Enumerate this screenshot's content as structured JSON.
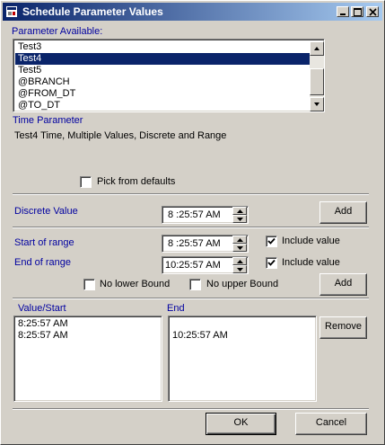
{
  "window": {
    "title": "Schedule Parameter Values"
  },
  "params": {
    "label": "Parameter Available:",
    "items": [
      {
        "text": "Test3",
        "selected": false
      },
      {
        "text": "Test4",
        "selected": true
      },
      {
        "text": "Test5",
        "selected": false
      },
      {
        "text": "@BRANCH",
        "selected": false
      },
      {
        "text": "@FROM_DT",
        "selected": false
      },
      {
        "text": "@TO_DT",
        "selected": false
      }
    ]
  },
  "time_param": {
    "label": "Time Parameter",
    "description": "Test4  Time,  Multiple Values,  Discrete and Range"
  },
  "pick_defaults": {
    "label": "Pick from defaults",
    "checked": false
  },
  "discrete": {
    "label": "Discrete Value",
    "value": "8 :25:57 AM",
    "add_label": "Add"
  },
  "range": {
    "start_label": "Start of range",
    "start_value": "8 :25:57 AM",
    "start_include_label": "Include value",
    "start_include_checked": true,
    "end_label": "End of range",
    "end_value": "10:25:57 AM",
    "end_include_label": "Include value",
    "end_include_checked": true,
    "no_lower_label": "No lower Bound",
    "no_upper_label": "No upper Bound",
    "add_label": "Add"
  },
  "values": {
    "start_header": "Value/Start",
    "end_header": "End",
    "start_items": [
      "8:25:57 AM",
      "8:25:57 AM"
    ],
    "end_items": [
      "",
      "10:25:57 AM"
    ],
    "remove_label": "Remove"
  },
  "footer": {
    "ok_label": "OK",
    "cancel_label": "Cancel"
  }
}
